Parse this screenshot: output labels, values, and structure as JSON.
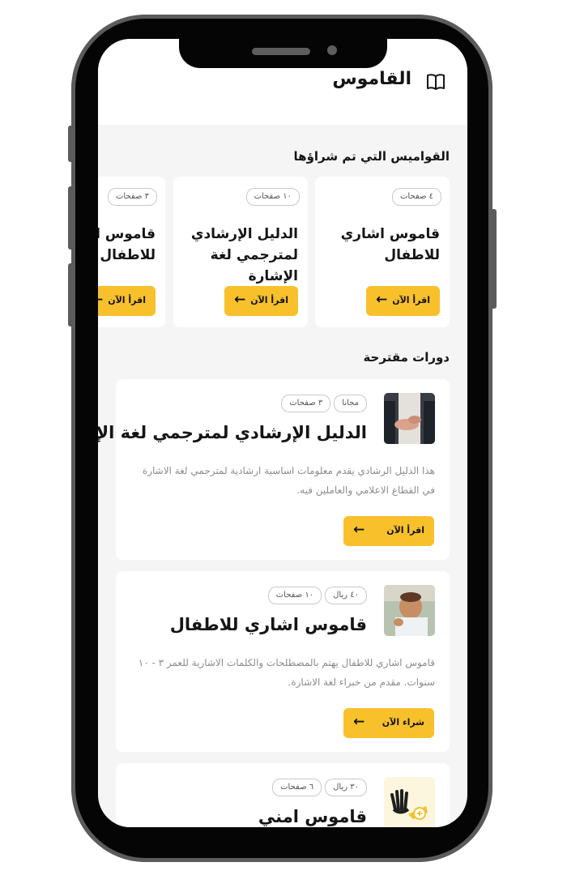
{
  "header": {
    "title": "القاموس"
  },
  "purchased": {
    "title": "القواميس التي تم شراؤها",
    "items": [
      {
        "pages": "٤ صفحات",
        "title": "قاموس اشاري للاطفال",
        "button": "اقرأ الآن"
      },
      {
        "pages": "١٠ صفحات",
        "title": "الدليل الإرشادي لمترجمي لغة الإشارة",
        "button": "اقرأ الآن"
      },
      {
        "pages": "٣ صفحات",
        "title": "قاموس اشاري للاطفال",
        "button": "اقرأ الآن"
      }
    ]
  },
  "suggested": {
    "title": "دورات مقترحة",
    "items": [
      {
        "price": "مجانا",
        "pages": "٣ صفحات",
        "title": "الدليل الإرشادي لمترجمي لغة الإشارة",
        "desc": "هذا الدليل الرشادي يقدم معلومات اساسية ارشادية لمترجمي لغة الاشارة في القطاع الاعلامي والعاملين فيه.",
        "button": "اقرأ الآن"
      },
      {
        "price": "٤٠ ريال",
        "pages": "١٠ صفحات",
        "title": "قاموس اشاري للاطفال",
        "desc": "قاموس اشاري للاطفال يهتم بالمصطلحات والكلمات الاشارية للعمر ٣ - ١٠ سنوات. مقدم من خبراء لغة الاشارة.",
        "button": "شراء الآن"
      },
      {
        "price": "٣٠ ريال",
        "pages": "٦ صفحات",
        "title": "قاموس امني"
      }
    ]
  },
  "colors": {
    "accent": "#f8c12c",
    "background": "#f5f5f5",
    "card": "#ffffff"
  },
  "icons": {
    "header": "book-open-icon",
    "button": "arrow-left-icon"
  }
}
